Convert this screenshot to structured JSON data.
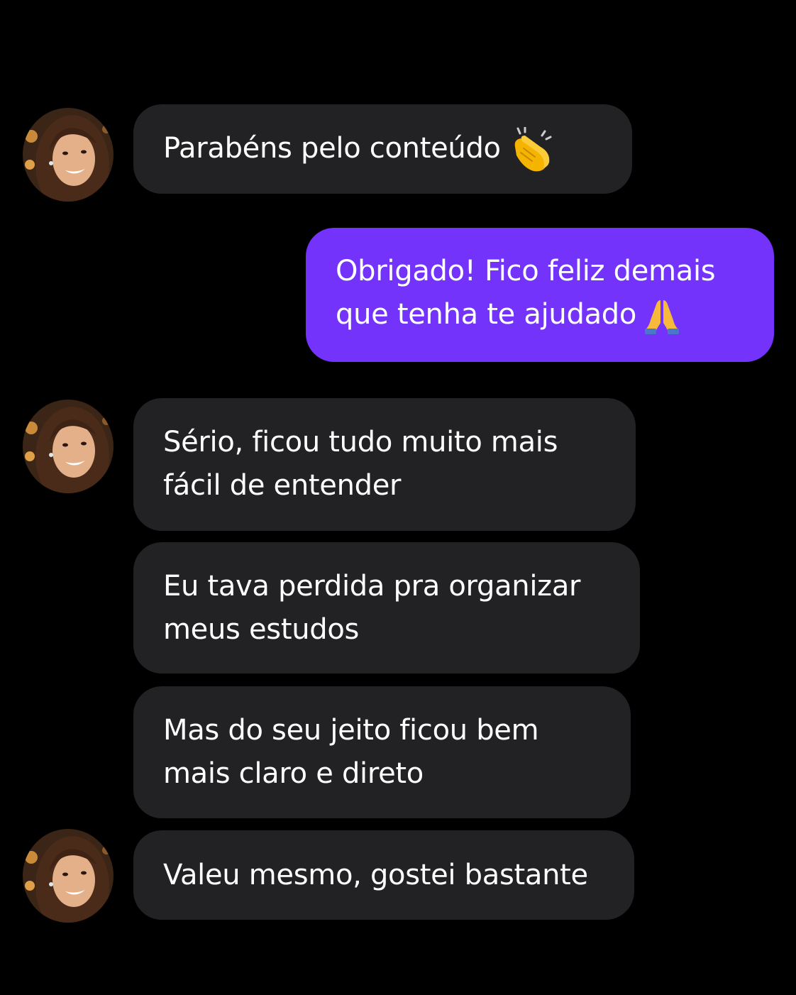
{
  "conversation": {
    "messages": [
      {
        "sender": "contact",
        "lines": [
          "Parabéns pelo conteúdo"
        ],
        "emoji": "clapping-hands-icon"
      },
      {
        "sender": "me",
        "lines": [
          "Obrigado! Fico feliz demais",
          "que tenha te ajudado"
        ],
        "emoji": "folded-hands-icon"
      },
      {
        "sender": "contact",
        "lines": [
          "Sério, ficou tudo muito mais",
          "fácil de entender"
        ]
      },
      {
        "sender": "contact",
        "lines": [
          "Eu tava perdida pra organizar",
          "meus estudos"
        ]
      },
      {
        "sender": "contact",
        "lines": [
          "Mas do seu jeito ficou bem",
          "mais claro e direto"
        ]
      },
      {
        "sender": "contact",
        "lines": [
          "Valeu mesmo, gostei bastante"
        ]
      }
    ]
  },
  "colors": {
    "background": "#000000",
    "incoming_bubble": "#222224",
    "outgoing_bubble": "#7433fb",
    "text": "#ffffff"
  },
  "icons": {
    "avatar": "contact-avatar-photo",
    "clap": "clapping-hands-icon",
    "pray": "folded-hands-icon"
  }
}
